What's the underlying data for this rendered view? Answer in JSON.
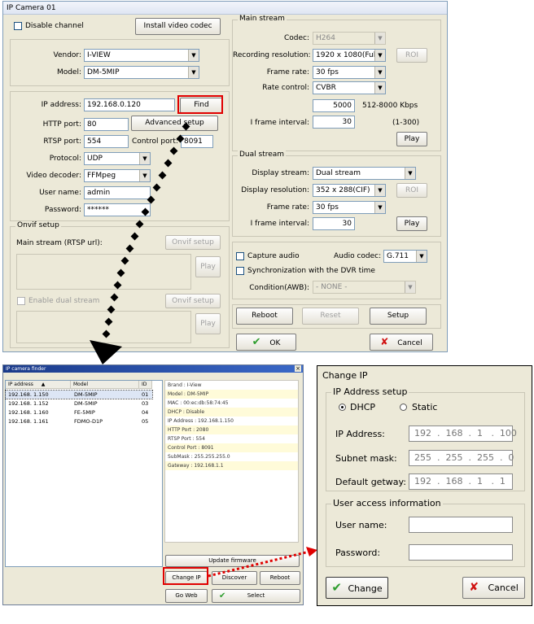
{
  "main_window": {
    "title": "IP Camera 01",
    "disable_channel": "Disable channel",
    "install_codec": "Install video codec",
    "vendor_label": "Vendor:",
    "vendor": "I-VIEW",
    "model_label": "Model:",
    "model": "DM-5MIP",
    "ip_label": "IP address:",
    "ip": "192.168.0.120",
    "find": "Find",
    "http_label": "HTTP port:",
    "http": "80",
    "advanced": "Advanced setup",
    "rtsp_label": "RTSP port:",
    "rtsp": "554",
    "control_label": "Control port:",
    "control": "8091",
    "protocol_label": "Protocol:",
    "protocol": "UDP",
    "decoder_label": "Video decoder:",
    "decoder": "FFMpeg",
    "user_label": "User name:",
    "user": "admin",
    "pass_label": "Password:",
    "pass": "******",
    "onvif_legend": "Onvif setup",
    "main_stream_rtsp": "Main stream (RTSP url):",
    "onvif_setup": "Onvif setup",
    "play": "Play",
    "enable_dual": "Enable dual stream",
    "main_stream_legend": "Main stream",
    "codec_label": "Codec:",
    "codec": "H264",
    "rec_res_label": "Recording resolution:",
    "rec_res": "1920 x 1080(Full",
    "roi": "ROI",
    "frame_rate_label": "Frame rate:",
    "frame_rate": "30 fps",
    "rate_control_label": "Rate control:",
    "rate_control": "CVBR",
    "bitrate": "5000",
    "bitrate_range": "512-8000 Kbps",
    "iframe_label": "I frame interval:",
    "iframe": "30",
    "iframe_range": "(1-300)",
    "dual_legend": "Dual stream",
    "display_stream_label": "Display stream:",
    "display_stream": "Dual stream",
    "display_res_label": "Display resolution:",
    "display_res": "352 x 288(CIF)",
    "dual_frame_rate": "30 fps",
    "dual_iframe": "30",
    "capture_audio": "Capture audio",
    "audio_codec_label": "Audio codec:",
    "audio_codec": "G.711",
    "sync_dvr": "Synchronization with the DVR time",
    "condition_label": "Condition(AWB):",
    "condition": "- NONE -",
    "reboot": "Reboot",
    "reset": "Reset",
    "setup": "Setup",
    "ok": "OK",
    "cancel": "Cancel"
  },
  "finder": {
    "title": "IP camera finder",
    "col_ip": "IP address",
    "col_model": "Model",
    "col_id": "ID",
    "rows": [
      {
        "ip": "192.168.  1.150",
        "model": "DM-5MIP",
        "id": "01"
      },
      {
        "ip": "192.168.  1.152",
        "model": "DM-5MIP",
        "id": "03"
      },
      {
        "ip": "192.168.  1.160",
        "model": "FE-5MIP",
        "id": "04"
      },
      {
        "ip": "192.168.  1.161",
        "model": "FDMO-D1P",
        "id": "05"
      }
    ],
    "info": [
      "Brand : I-View",
      "Model : DM-5MIP",
      "MAC : 00:ec:db:58:74:45",
      "DHCP : Disable",
      "IP Address : 192.168.1.150",
      "HTTP Port : 2080",
      "RTSP Port : 554",
      "Control Port : 8091",
      "SubMask : 255.255.255.0",
      "Gateway : 192.168.1.1"
    ],
    "update_firmware": "Update firmware",
    "change_ip": "Change IP",
    "discover": "Discover",
    "reboot": "Reboot",
    "go_web": "Go Web",
    "select": "Select"
  },
  "change_ip": {
    "title": "Change IP",
    "ip_setup_legend": "IP Address setup",
    "dhcp": "DHCP",
    "static": "Static",
    "ip_label": "IP Address:",
    "ip": "192  .  168  .  1   .  100",
    "mask_label": "Subnet mask:",
    "mask": "255  .  255  .  255  .  0",
    "gw_label": "Default getway:",
    "gw": "192  .  168  .  1   .  1",
    "user_legend": "User access information",
    "user_label": "User name:",
    "pass_label": "Password:",
    "change": "Change",
    "cancel": "Cancel"
  },
  "colors": {
    "highlight_red": "#e00000",
    "ok_check": "#2e9d2e",
    "cancel_x": "#d01010"
  }
}
